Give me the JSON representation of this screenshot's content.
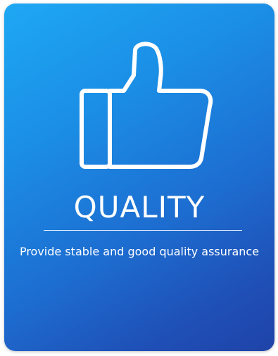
{
  "card": {
    "icon": "thumbs-up-icon",
    "title": "QUALITY",
    "description": "Provide stable and good quality assurance",
    "colors": {
      "gradient_start": "#1ea8f4",
      "gradient_end": "#1f43a8",
      "text": "#ffffff"
    }
  }
}
